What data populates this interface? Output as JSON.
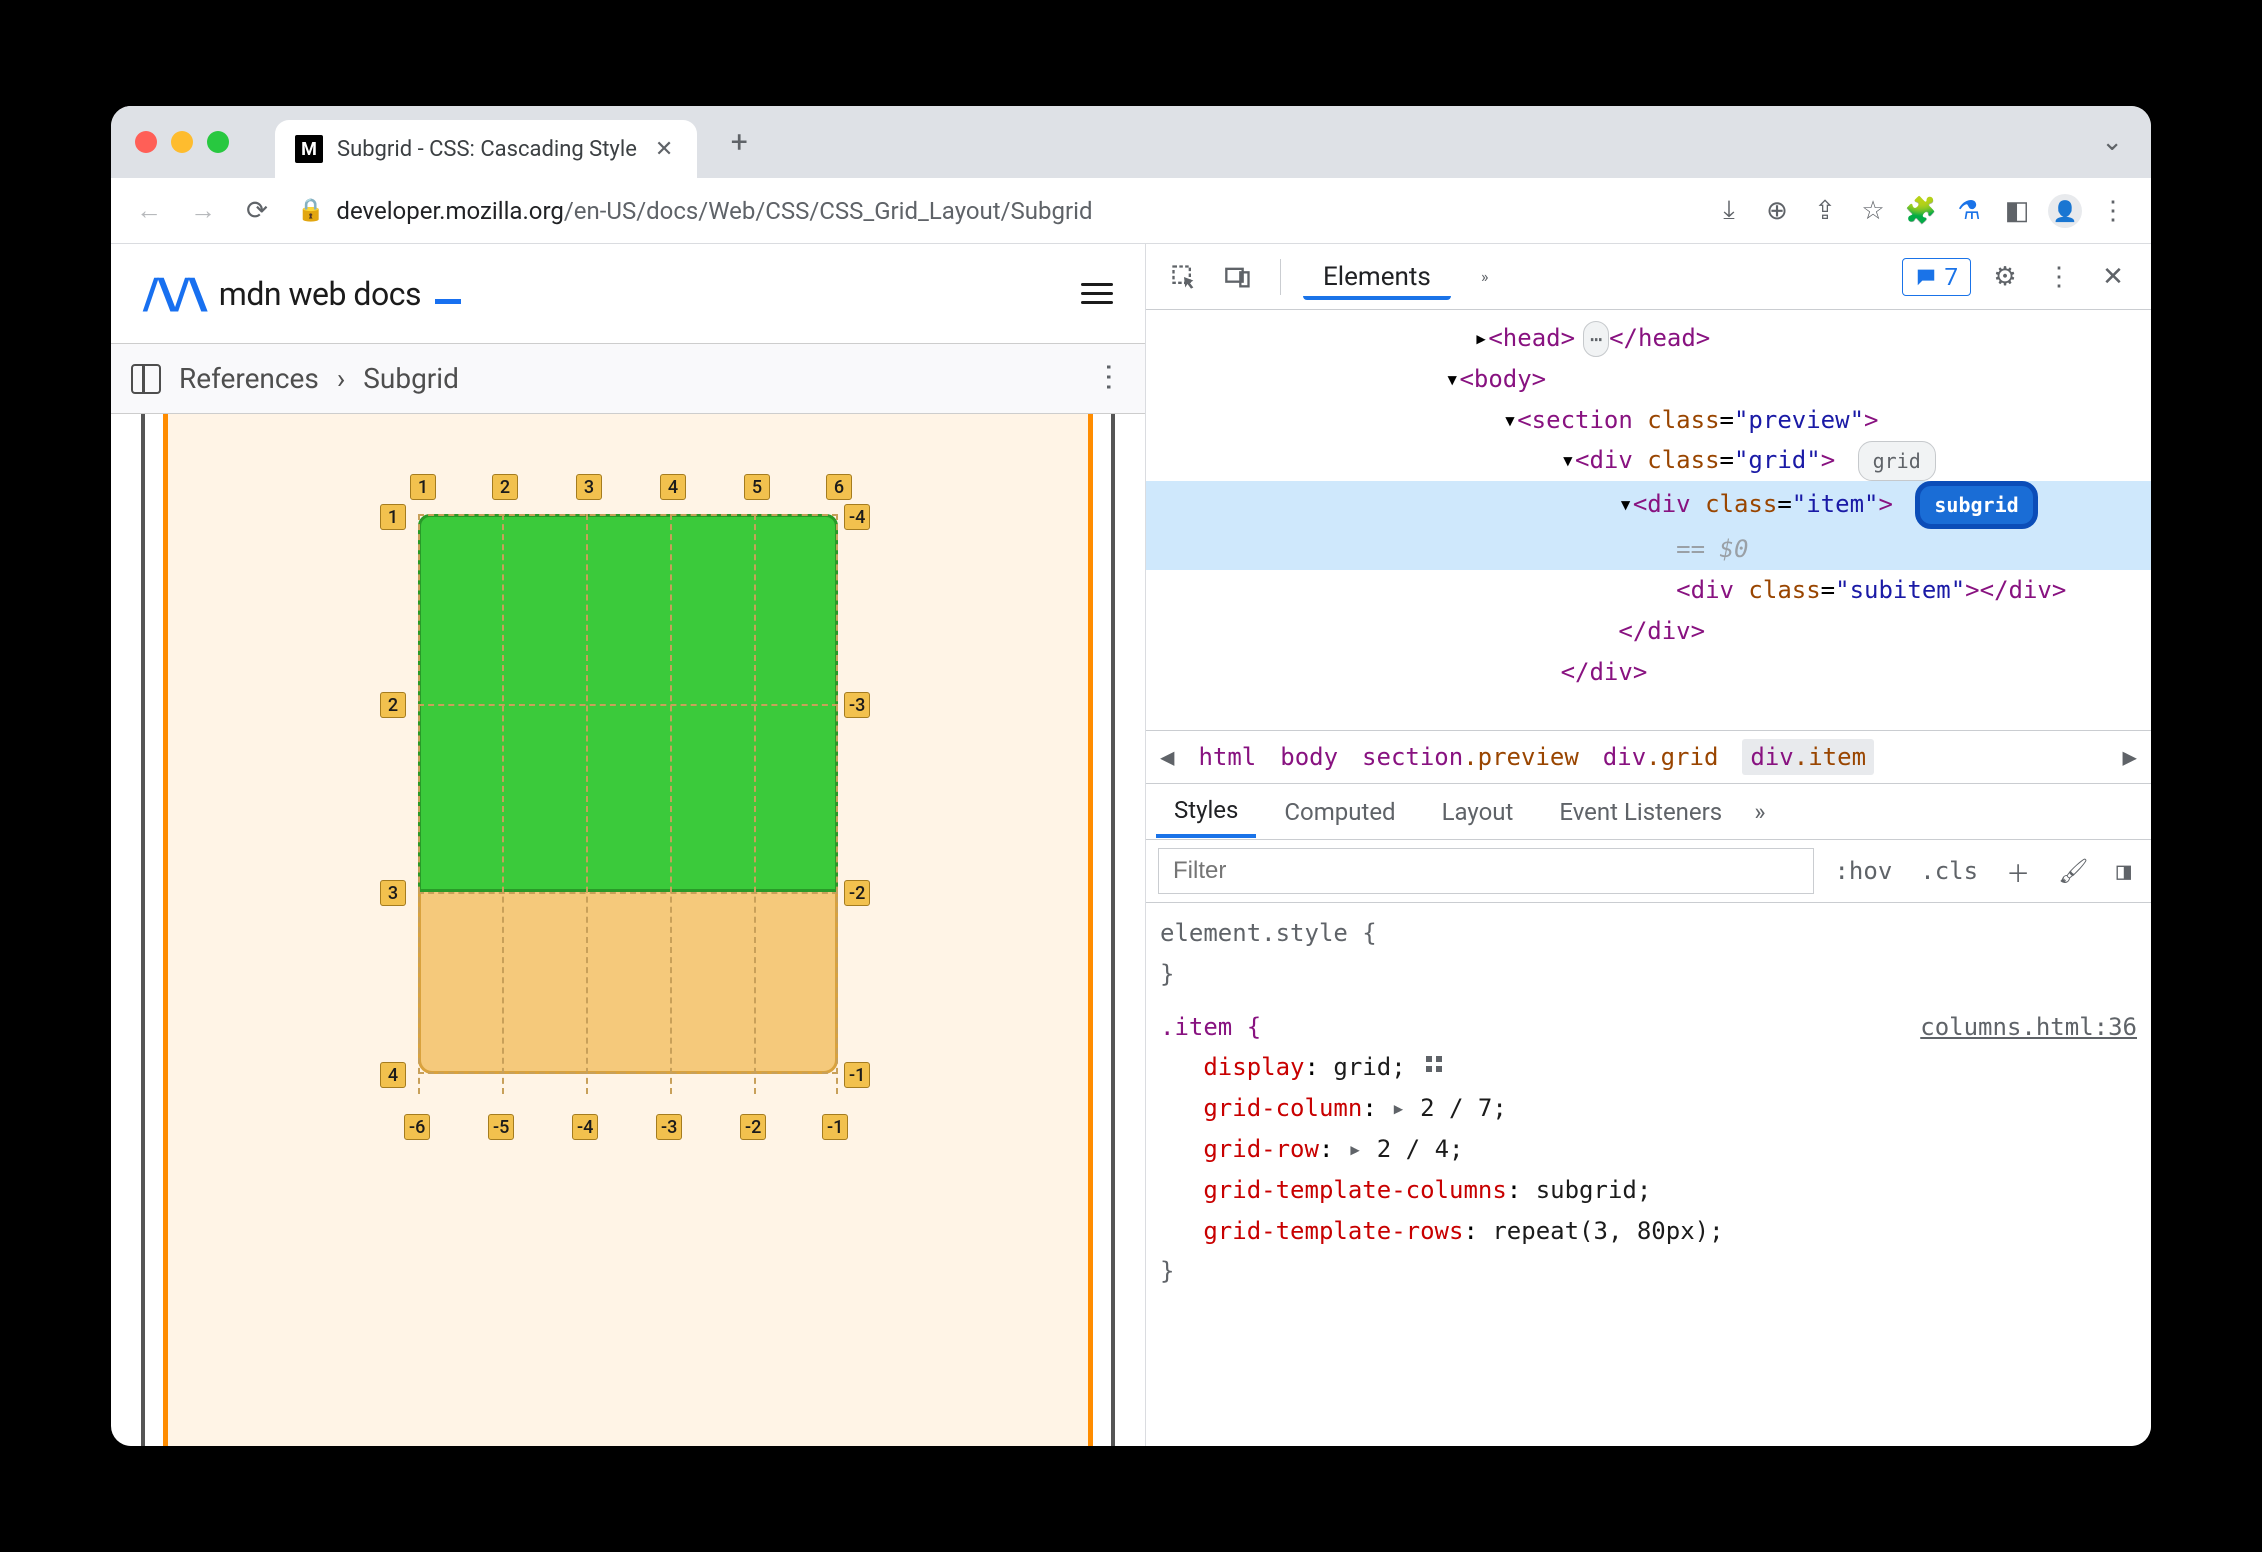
{
  "browser": {
    "tab_title": "Subgrid - CSS: Cascading Style",
    "favicon_letter": "M",
    "url_host": "developer.mozilla.org",
    "url_path": "/en-US/docs/Web/CSS/CSS_Grid_Layout/Subgrid"
  },
  "mdn": {
    "logo_text": "mdn web docs",
    "bc_ref": "References",
    "bc_current": "Subgrid"
  },
  "grid_preview": {
    "top_labels": [
      "1",
      "2",
      "3",
      "4",
      "5",
      "6"
    ],
    "bottom_labels": [
      "-6",
      "-5",
      "-4",
      "-3",
      "-2",
      "-1"
    ],
    "left_labels": [
      "1",
      "2",
      "3",
      "4"
    ],
    "right_labels": [
      "-4",
      "-3",
      "-2",
      "-1"
    ]
  },
  "devtools": {
    "panel": "Elements",
    "issues_count": "7",
    "dom": {
      "l1": "<head>…</head>",
      "l2": "<body>",
      "l3_open": "<section class=\"preview\">",
      "l4_open": "<div class=\"grid\">",
      "grid_pill": "grid",
      "l5_open": "<div class=\"item\">",
      "subgrid_pill": "subgrid",
      "eq0": "== $0",
      "l6": "<div class=\"subitem\"></div>",
      "l7": "</div>",
      "l8": "</div>"
    },
    "breadcrumb": [
      "html",
      "body",
      "section.preview",
      "div.grid",
      "div.item"
    ],
    "styles_tabs": [
      "Styles",
      "Computed",
      "Layout",
      "Event Listeners"
    ],
    "filter_placeholder": "Filter",
    "hov": ":hov",
    "cls": ".cls",
    "element_style": "element.style {",
    "rule_selector": ".item {",
    "rule_source": "columns.html:36",
    "rules": [
      {
        "prop": "display",
        "val": "grid;",
        "grid": true
      },
      {
        "prop": "grid-column",
        "val": "▸ 2 / 7;"
      },
      {
        "prop": "grid-row",
        "val": "▸ 2 / 4;"
      },
      {
        "prop": "grid-template-columns",
        "val": "subgrid;"
      },
      {
        "prop": "grid-template-rows",
        "val": "repeat(3, 80px);"
      }
    ],
    "close_brace": "}"
  }
}
